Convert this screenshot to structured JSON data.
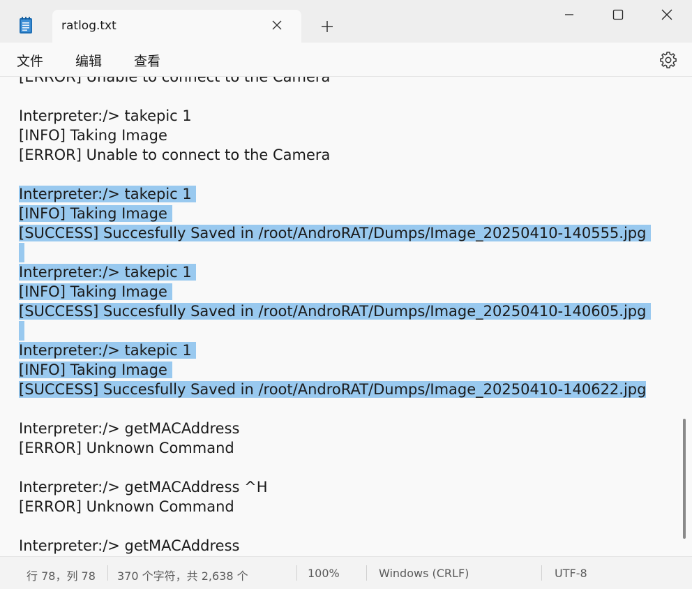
{
  "tab": {
    "title": "ratlog.txt",
    "close_icon": "close-icon"
  },
  "menu": {
    "file": "文件",
    "edit": "编辑",
    "view": "查看"
  },
  "editor": {
    "lines": [
      {
        "text": "[ERROR] Unable to connect to the Camera",
        "selected": false
      },
      {
        "text": "",
        "selected": false
      },
      {
        "text": "Interpreter:/> takepic 1",
        "selected": false
      },
      {
        "text": "[INFO] Taking Image",
        "selected": false
      },
      {
        "text": "[ERROR] Unable to connect to the Camera",
        "selected": false
      },
      {
        "text": "",
        "selected": false
      },
      {
        "text": "Interpreter:/> takepic 1 ",
        "selected": true
      },
      {
        "text": "[INFO] Taking Image ",
        "selected": true
      },
      {
        "text": "[SUCCESS] Succesfully Saved in /root/AndroRAT/Dumps/Image_20250410-140555.jpg ",
        "selected": true
      },
      {
        "text": "",
        "selected": true
      },
      {
        "text": "Interpreter:/> takepic 1 ",
        "selected": true
      },
      {
        "text": "[INFO] Taking Image ",
        "selected": true
      },
      {
        "text": "[SUCCESS] Succesfully Saved in /root/AndroRAT/Dumps/Image_20250410-140605.jpg ",
        "selected": true
      },
      {
        "text": "",
        "selected": true
      },
      {
        "text": "Interpreter:/> takepic 1 ",
        "selected": true
      },
      {
        "text": "[INFO] Taking Image ",
        "selected": true
      },
      {
        "text": "[SUCCESS] Succesfully Saved in /root/AndroRAT/Dumps/Image_20250410-140622.jpg",
        "selected": true
      },
      {
        "text": "",
        "selected": false
      },
      {
        "text": "Interpreter:/> getMACAddress",
        "selected": false
      },
      {
        "text": "[ERROR] Unknown Command",
        "selected": false
      },
      {
        "text": "",
        "selected": false
      },
      {
        "text": "Interpreter:/> getMACAddress ^H",
        "selected": false
      },
      {
        "text": "[ERROR] Unknown Command",
        "selected": false
      },
      {
        "text": "",
        "selected": false
      },
      {
        "text": "Interpreter:/> getMACAddress",
        "selected": false
      }
    ]
  },
  "status": {
    "position": "行 78，列 78",
    "selection": "370 个字符，共 2,638 个",
    "zoom": "100%",
    "line_ending": "Windows (CRLF)",
    "encoding": "UTF-8"
  },
  "colors": {
    "selection": "#99c9ef",
    "titlebar": "#eeeeee",
    "editor_bg": "#f9f9f9",
    "app_icon": "#1f6fb5"
  },
  "icons": {
    "app": "notepad-icon",
    "new_tab": "plus-icon",
    "minimize": "minimize-icon",
    "maximize": "maximize-icon",
    "close": "close-icon",
    "settings": "gear-icon"
  }
}
